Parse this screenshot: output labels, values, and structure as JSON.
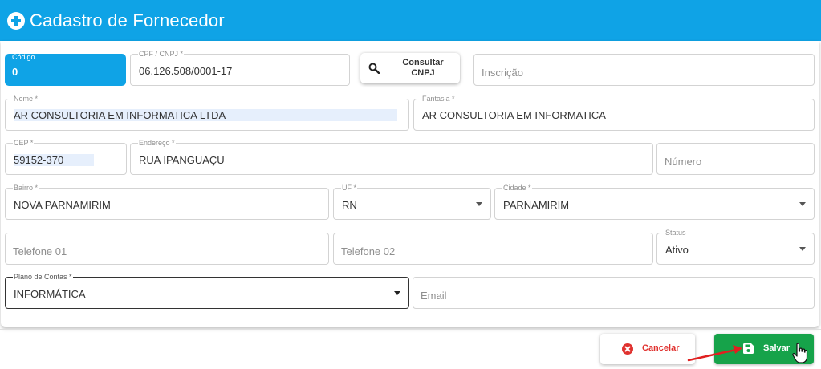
{
  "header": {
    "title": "Cadastro de Fornecedor"
  },
  "form": {
    "codigo": {
      "label": "Código",
      "value": "0"
    },
    "cpf_cnpj": {
      "label": "CPF / CNPJ *",
      "value": "06.126.508/0001-17"
    },
    "consultar_button": {
      "label": "Consultar CNPJ"
    },
    "inscricao": {
      "placeholder": "Inscrição"
    },
    "nome": {
      "label": "Nome *",
      "value": "AR CONSULTORIA EM INFORMATICA LTDA"
    },
    "fantasia": {
      "label": "Fantasia *",
      "value": "AR CONSULTORIA EM INFORMATICA"
    },
    "cep": {
      "label": "CEP *",
      "value": "59152-370"
    },
    "endereco": {
      "label": "Endereço *",
      "value": "RUA IPANGUAÇU"
    },
    "numero": {
      "placeholder": "Número"
    },
    "bairro": {
      "label": "Bairro *",
      "value": "NOVA PARNAMIRIM"
    },
    "uf": {
      "label": "UF *",
      "value": "RN"
    },
    "cidade": {
      "label": "Cidade *",
      "value": "PARNAMIRIM"
    },
    "telefone1": {
      "placeholder": "Telefone 01"
    },
    "telefone2": {
      "placeholder": "Telefone 02"
    },
    "status": {
      "label": "Status",
      "value": "Ativo"
    },
    "plano_contas": {
      "label": "Plano de Contas *",
      "value": "INFORMÁTICA"
    },
    "email": {
      "placeholder": "Email"
    }
  },
  "footer": {
    "cancel_label": "Cancelar",
    "save_label": "Salvar"
  },
  "colors": {
    "header": "#0fa3e6",
    "save": "#16a34a",
    "cancel_text": "#e0322f",
    "annotation_arrow": "#e02020"
  },
  "icons": {
    "header": "plus-circle-icon",
    "consultar": "search-icon",
    "cancel": "x-circle-icon",
    "save": "floppy-disk-icon"
  }
}
